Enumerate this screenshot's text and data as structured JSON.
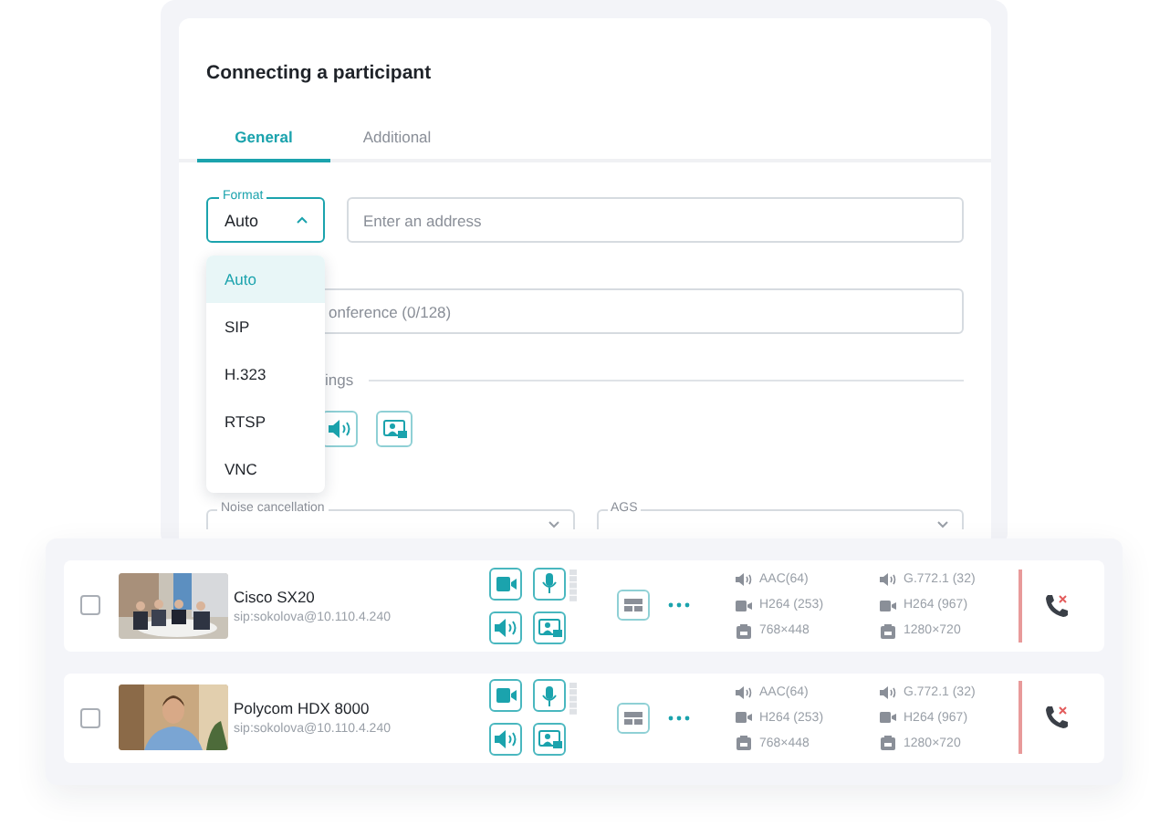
{
  "dialog": {
    "title": "Connecting a participant",
    "tabs": [
      {
        "label": "General",
        "selected": true
      },
      {
        "label": "Additional",
        "selected": false
      }
    ],
    "format": {
      "label": "Format",
      "value": "Auto",
      "expanded": true,
      "options": [
        {
          "label": "Auto",
          "selected": true
        },
        {
          "label": "SIP",
          "selected": false
        },
        {
          "label": "H.323",
          "selected": false
        },
        {
          "label": "RTSP",
          "selected": false
        },
        {
          "label": "VNC",
          "selected": false
        }
      ]
    },
    "address": {
      "placeholder": "Enter an address"
    },
    "name_field": {
      "placeholder": "onference (0/128)"
    },
    "section_title": "ings",
    "selects": [
      {
        "label": "Noise cancellation"
      },
      {
        "label": "AGS"
      }
    ]
  },
  "participants": [
    {
      "name": "Cisco SX20",
      "address": "sip:sokolova@10.110.4.240",
      "checked": false,
      "stats": [
        {
          "kind": "audio",
          "left": "AAC(64)",
          "right": "G.772.1 (32)"
        },
        {
          "kind": "video",
          "left": "H264 (253)",
          "right": "H264 (967)"
        },
        {
          "kind": "resolution",
          "left": "768×448",
          "right": "1280×720"
        }
      ]
    },
    {
      "name": "Polycom HDX 8000",
      "address": "sip:sokolova@10.110.4.240",
      "checked": false,
      "stats": [
        {
          "kind": "audio",
          "left": "AAC(64)",
          "right": "G.772.1 (32)"
        },
        {
          "kind": "video",
          "left": "H264 (253)",
          "right": "H264 (967)"
        },
        {
          "kind": "resolution",
          "left": "768×448",
          "right": "1280×720"
        }
      ]
    }
  ]
}
